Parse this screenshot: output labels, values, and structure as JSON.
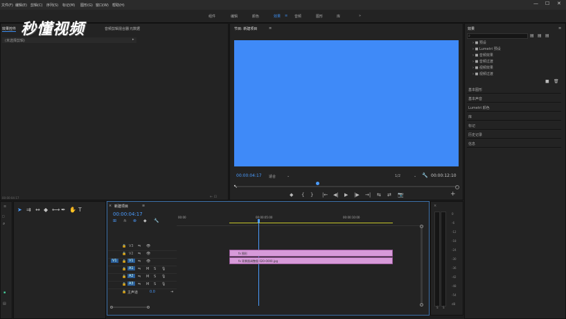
{
  "menu": [
    "文件(F)",
    "编辑(E)",
    "剪辑(C)",
    "序列(S)",
    "标记(M)",
    "图形(G)",
    "窗口(W)",
    "帮助(H)"
  ],
  "window_controls": [
    "—",
    "☐",
    "✕"
  ],
  "workspaces": [
    "组件",
    "编辑",
    "颜色",
    "效果",
    "音频",
    "图形",
    "库"
  ],
  "workspace_more": "»",
  "watermark": "秒懂视频",
  "source_panel": {
    "tabs": [
      "效果控件",
      "音频剪辑混合器",
      "元数据"
    ],
    "tab_active": "效果控件",
    "subheader": "(未选择剪辑)",
    "footer_time": "00:00:04:17"
  },
  "program": {
    "title": "节目: 新建项目",
    "title_menu": "≡",
    "current_time": "00:00:04:17",
    "fit": "适合",
    "resolution": "1/2",
    "duration": "00:00:12:10",
    "controls": [
      "◆",
      "{",
      "}",
      "|←",
      "◀|",
      "▶",
      "|▶",
      "→|",
      "⇆",
      "⇄",
      "📷"
    ],
    "add": "+"
  },
  "effects": {
    "title": "效果",
    "title_menu": "≡",
    "folders": [
      "预设",
      "Lumetri 预设",
      "音频效果",
      "音频过渡",
      "视频效果",
      "视频过渡"
    ],
    "sections": [
      "基本图形",
      "基本声音",
      "Lumetri 颜色",
      "库",
      "标记",
      "历史记录",
      "信息"
    ]
  },
  "timeline": {
    "title": "新建项目",
    "title_menu": "≡",
    "current_time": "00:00:04:17",
    "ruler": [
      "00:00",
      "00:00:05:00",
      "00:00:10:00"
    ],
    "tracks": [
      {
        "label": "V3",
        "src": ""
      },
      {
        "label": "V2",
        "src": ""
      },
      {
        "label": "V1",
        "src": "V1"
      },
      {
        "label": "A1",
        "src": ""
      },
      {
        "label": "A2",
        "src": "A2"
      },
      {
        "label": "A3",
        "src": ""
      }
    ],
    "master_label": "主声道",
    "master_value": "0.0",
    "clips": [
      {
        "label": "fx 图形"
      },
      {
        "label": "fx 背景图调整图 020-0000.jpg"
      }
    ]
  },
  "meter": {
    "ticks": [
      "0",
      "-6",
      "-12",
      "-18",
      "-24",
      "-30",
      "-36",
      "-42",
      "-48",
      "-54",
      "dB"
    ],
    "solo": [
      "S",
      "S"
    ]
  },
  "colors": {
    "video": "#3f8af8",
    "timecode": "#4b9cff",
    "clip": "#d79ad9",
    "accent": "#3d8ef0"
  }
}
